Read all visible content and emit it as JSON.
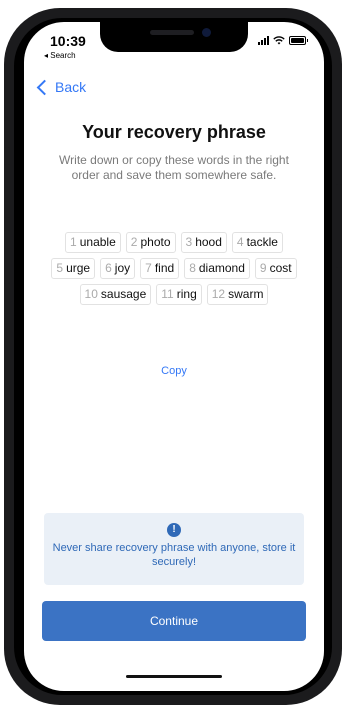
{
  "status": {
    "time": "10:39",
    "back_app": "◂ Search"
  },
  "nav": {
    "back_label": "Back"
  },
  "title": "Your recovery phrase",
  "subtitle": "Write down or copy these words in the right order and save them somewhere safe.",
  "words": [
    {
      "num": "1",
      "word": "unable"
    },
    {
      "num": "2",
      "word": "photo"
    },
    {
      "num": "3",
      "word": "hood"
    },
    {
      "num": "4",
      "word": "tackle"
    },
    {
      "num": "5",
      "word": "urge"
    },
    {
      "num": "6",
      "word": "joy"
    },
    {
      "num": "7",
      "word": "find"
    },
    {
      "num": "8",
      "word": "diamond"
    },
    {
      "num": "9",
      "word": "cost"
    },
    {
      "num": "10",
      "word": "sausage"
    },
    {
      "num": "11",
      "word": "ring"
    },
    {
      "num": "12",
      "word": "swarm"
    }
  ],
  "copy_label": "Copy",
  "warning": {
    "icon": "exclamation-icon",
    "text": "Never share recovery phrase with anyone, store it securely!"
  },
  "continue_label": "Continue",
  "colors": {
    "accent": "#3478f6",
    "button": "#3b73c4",
    "warning_bg": "#eaf0f7",
    "warning_text": "#2f69b7"
  }
}
